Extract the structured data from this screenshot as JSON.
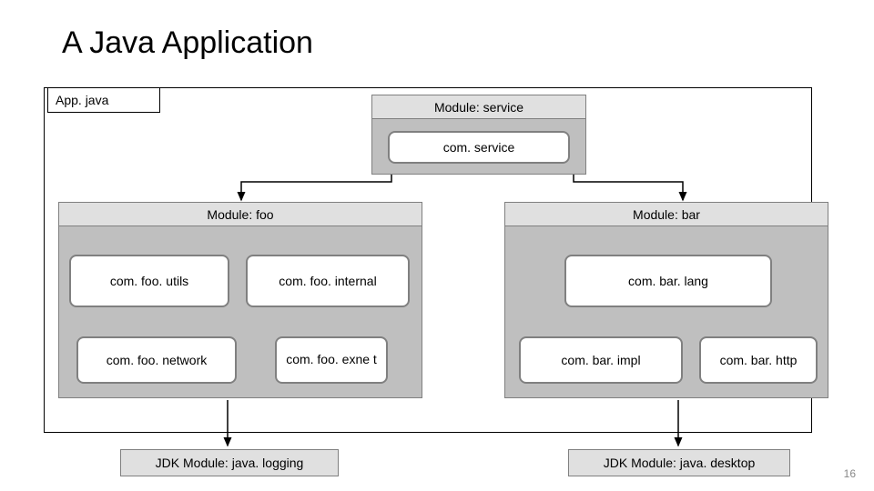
{
  "title": "A Java Application",
  "app_file": "App. java",
  "modules": {
    "service": {
      "label": "Module: service",
      "packages": [
        "com. service"
      ]
    },
    "foo": {
      "label": "Module: foo",
      "packages": [
        "com. foo. utils",
        "com. foo. internal",
        "com. foo. network",
        "com. foo. exne t"
      ]
    },
    "bar": {
      "label": "Module: bar",
      "packages": [
        "com. bar. lang",
        "com. bar. impl",
        "com. bar. http"
      ]
    }
  },
  "jdk_modules": [
    "JDK Module: java. logging",
    "JDK Module: java. desktop"
  ],
  "slide_number": "16",
  "colors": {
    "module_header": "#e0e0e0",
    "module_body": "#bfbfbf",
    "package_box": "#ffffff",
    "package_border": "#808080"
  }
}
